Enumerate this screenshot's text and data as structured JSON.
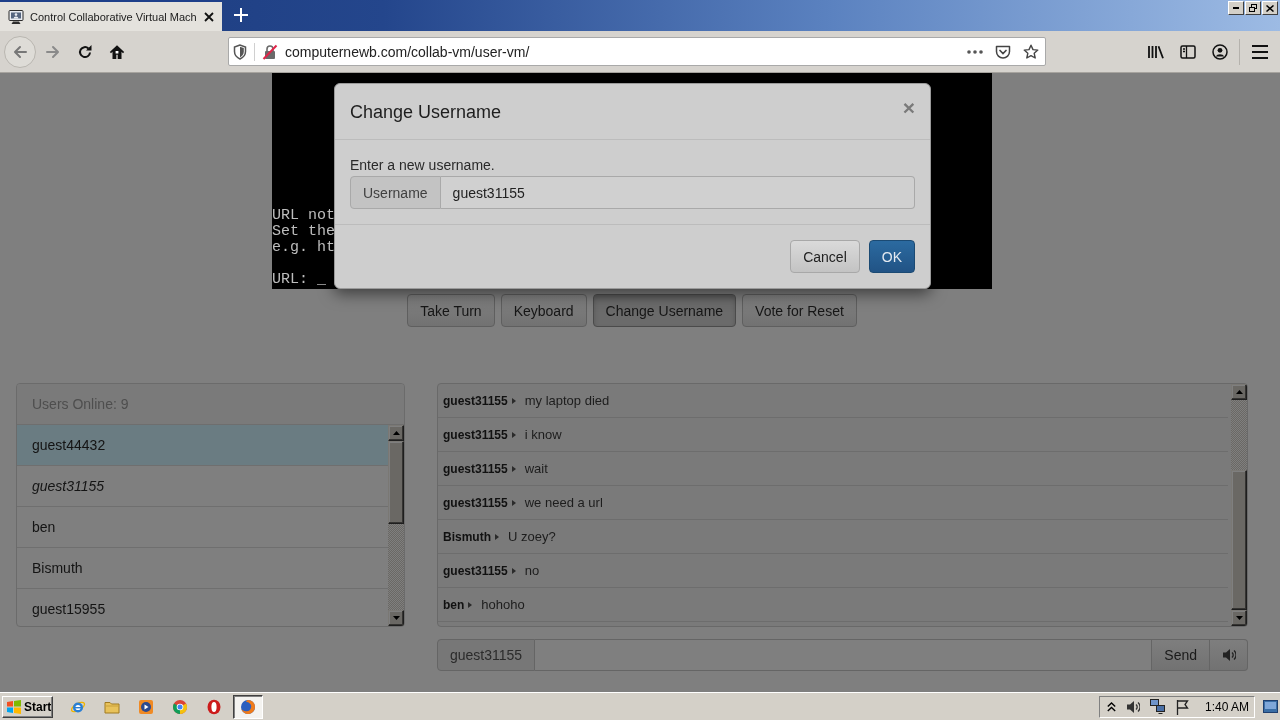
{
  "browser": {
    "tabs": [
      {
        "title": "Control Collaborative Virtual Mach",
        "selected": true
      }
    ],
    "url": "computernewb.com/collab-vm/user-vm/"
  },
  "vm": {
    "console": [
      [
        "URL not",
        "Set the",
        "e.g. ht"
      ],
      [
        "URL: _"
      ]
    ],
    "buttons": [
      {
        "label": "Take Turn",
        "active": false
      },
      {
        "label": "Keyboard",
        "active": false
      },
      {
        "label": "Change Username",
        "active": true
      },
      {
        "label": "Vote for Reset",
        "active": false
      }
    ]
  },
  "modal": {
    "title": "Change Username",
    "close": "×",
    "prompt": "Enter a new username.",
    "field": {
      "addon": "Username",
      "value": "guest31155"
    },
    "buttons": [
      {
        "label": "Cancel",
        "kind": "dismiss"
      },
      {
        "label": "OK",
        "kind": "confirm"
      }
    ]
  },
  "users": {
    "header": "Users Online: 9",
    "items": [
      {
        "name": "guest44432",
        "highlighted": true,
        "current": false
      },
      {
        "name": "guest31155",
        "highlighted": false,
        "current": true
      },
      {
        "name": "ben",
        "highlighted": false,
        "current": false
      },
      {
        "name": "Bismuth",
        "highlighted": false,
        "current": false
      },
      {
        "name": "guest15955",
        "highlighted": false,
        "current": false
      }
    ]
  },
  "chat": {
    "messages": [
      {
        "user": "guest31155",
        "text": "my laptop died"
      },
      {
        "user": "guest31155",
        "text": "i know"
      },
      {
        "user": "guest31155",
        "text": "wait"
      },
      {
        "user": "guest31155",
        "text": "we need a url"
      },
      {
        "user": "Bismuth",
        "text": "U zoey?"
      },
      {
        "user": "guest31155",
        "text": "no"
      },
      {
        "user": "ben",
        "text": "hohoho"
      }
    ],
    "username": "guest31155",
    "send": "Send"
  },
  "taskbar": {
    "start": "Start",
    "apps": [
      {
        "active": false
      },
      {
        "active": false
      },
      {
        "active": false
      },
      {
        "active": false
      },
      {
        "active": false
      },
      {
        "active": true
      }
    ],
    "clock": "1:40 AM"
  }
}
